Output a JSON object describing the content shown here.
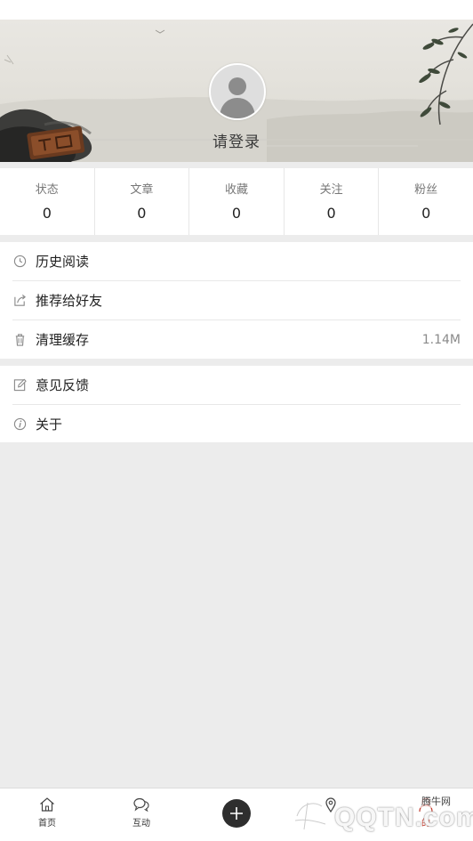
{
  "header": {
    "login_text": "请登录"
  },
  "stats": [
    {
      "label": "状态",
      "value": "0"
    },
    {
      "label": "文章",
      "value": "0"
    },
    {
      "label": "收藏",
      "value": "0"
    },
    {
      "label": "关注",
      "value": "0"
    },
    {
      "label": "粉丝",
      "value": "0"
    }
  ],
  "menu": {
    "section1": [
      {
        "label": "历史阅读",
        "icon": "clock-icon"
      },
      {
        "label": "推荐给好友",
        "icon": "share-icon"
      },
      {
        "label": "清理缓存",
        "icon": "trash-icon",
        "value": "1.14M"
      }
    ],
    "section2": [
      {
        "label": "意见反馈",
        "icon": "edit-icon"
      },
      {
        "label": "关于",
        "icon": "info-icon"
      }
    ]
  },
  "bottom_nav": [
    {
      "label": "首页",
      "icon": "home-icon"
    },
    {
      "label": "互动",
      "icon": "chat-bubbles-icon"
    },
    {
      "label": "",
      "icon": "add-icon"
    },
    {
      "label": "",
      "icon": "location-icon"
    },
    {
      "label": "的",
      "icon": "user-icon"
    }
  ],
  "watermark": {
    "logo_text": "QQTN.com",
    "site_text": "腾牛网"
  },
  "colors": {
    "background": "#ececec",
    "accent_active": "#c0392b",
    "add_button": "#2e2e2e"
  }
}
